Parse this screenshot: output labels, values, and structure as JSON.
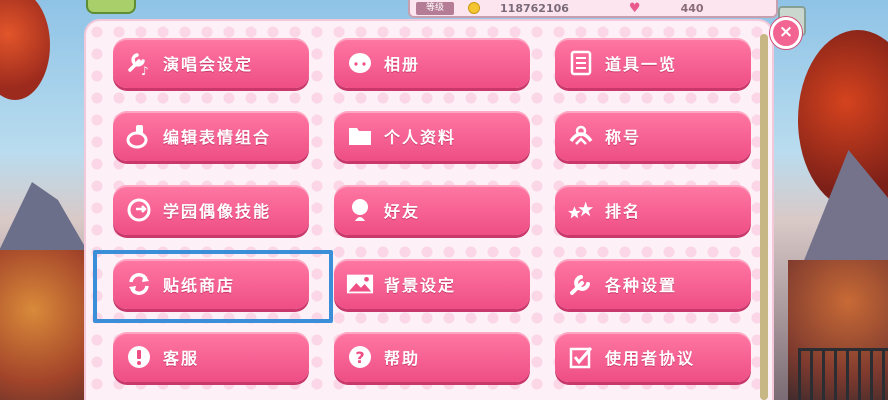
{
  "hud": {
    "rank": "等级",
    "money": "118762106",
    "lp": "440"
  },
  "close_label": "×",
  "menu": [
    {
      "label": "演唱会设定",
      "icon": "wrench-music-icon"
    },
    {
      "label": "相册",
      "icon": "face-icon"
    },
    {
      "label": "道具一览",
      "icon": "list-icon"
    },
    {
      "label": "编辑表情组合",
      "icon": "stamp-icon"
    },
    {
      "label": "个人资料",
      "icon": "folder-icon"
    },
    {
      "label": "称号",
      "icon": "title-badge-icon"
    },
    {
      "label": "学园偶像技能",
      "icon": "skill-icon"
    },
    {
      "label": "好友",
      "icon": "friend-icon"
    },
    {
      "label": "排名",
      "icon": "stars-icon"
    },
    {
      "label": "贴纸商店",
      "icon": "refresh-icon"
    },
    {
      "label": "背景设定",
      "icon": "picture-icon"
    },
    {
      "label": "各种设置",
      "icon": "wrench-icon"
    },
    {
      "label": "客服",
      "icon": "exclamation-icon"
    },
    {
      "label": "帮助",
      "icon": "question-icon"
    },
    {
      "label": "使用者协议",
      "icon": "checkbox-icon"
    }
  ]
}
